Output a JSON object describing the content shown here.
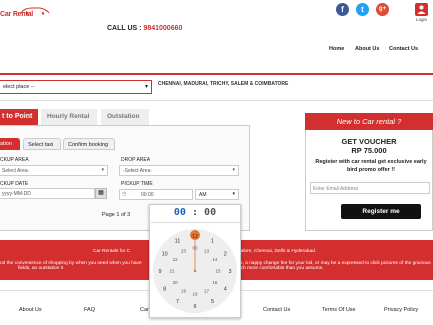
{
  "header": {
    "logo_text": "Car Rental",
    "call_label": "CALL US : ",
    "call_number": "9841000660",
    "social": {
      "facebook": "f",
      "twitter": "t",
      "google": "g+"
    },
    "login_label": "Login",
    "nav": [
      "Home",
      "About Us",
      "Contact Us"
    ]
  },
  "search": {
    "place_value": "elect place --",
    "cities": "CHENNAI, MADURAI, TRICHY, SALEM & COIMBATORE"
  },
  "tabs": [
    "t to Point",
    "Hourly Rental",
    "Outstation"
  ],
  "steps": [
    "ation",
    "Select taxi",
    "Confirm booking"
  ],
  "form": {
    "pickup_area_label": "CKUP AREA",
    "pickup_area_value": "Select Area-",
    "drop_area_label": "DROP AREA",
    "drop_area_value": "-Select Area-",
    "pickup_date_label": "CKUP DATE",
    "pickup_date_value": "yyyy-MM-DD",
    "pickup_time_label": "PICKUP TIME",
    "pickup_time_value": "00:00",
    "ampm_value": "AM",
    "page_info": "Page 1 of 3"
  },
  "voucher": {
    "header": "New to Car rental ?",
    "title": "GET VOUCHER",
    "amount": "RP 75.000",
    "desc": "Register with car rental get exclusive early bird promo offer !!",
    "email_placeholder": "Enter Email Address",
    "button": "Register me"
  },
  "band": {
    "line1a": "Car Rentals for C",
    "line1b": "galore, Chennai, Delhi & Hyderabad.",
    "line2": "nd the convenience of shopping by when you need when you have",
    "line2b": "eck, a nappy change fee for your kid, or may be a expressed to click pictures of the gracious",
    "line3": "fields, an outstation tr",
    "line3b": "much more comfortable than you assume."
  },
  "footer_nav": [
    "About Us",
    "FAQ",
    "Car",
    "Contact Us",
    "Terms Of Use",
    "Privacy Policy"
  ],
  "time_picker": {
    "hours": "00",
    "sep": ":",
    "minutes": "00",
    "dial_numbers": [
      "12",
      "1",
      "2",
      "3",
      "4",
      "5",
      "6",
      "7",
      "8",
      "9",
      "10",
      "11"
    ],
    "dial_inner": [
      "00",
      "13",
      "14",
      "15",
      "16",
      "17",
      "18",
      "19",
      "20",
      "21",
      "22",
      "23"
    ]
  },
  "colors": {
    "accent": "#d32f2f",
    "picker_accent": "#e57331"
  }
}
